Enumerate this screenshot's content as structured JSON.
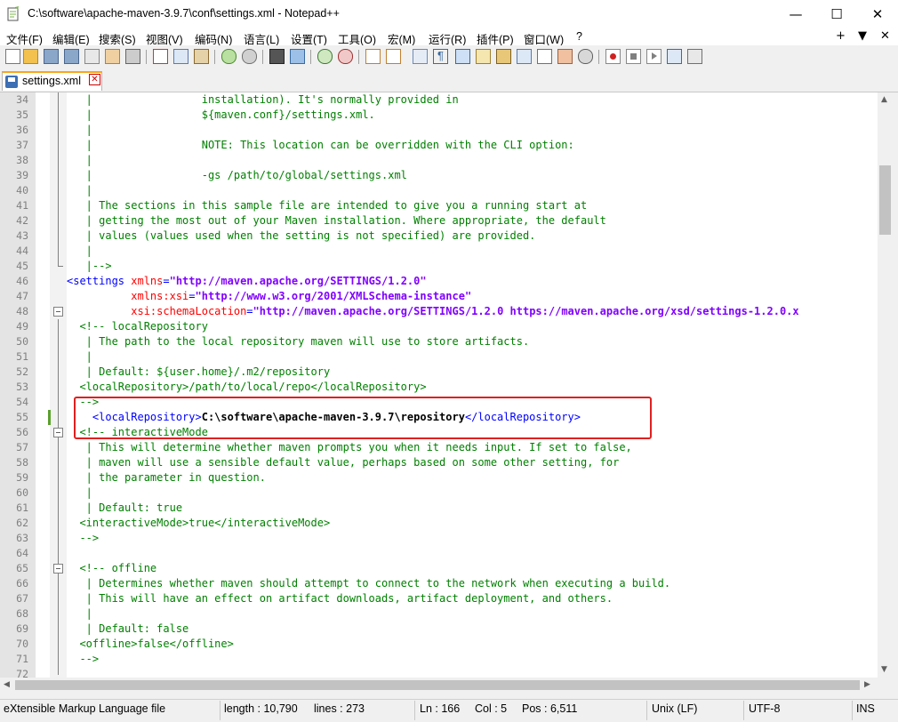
{
  "window": {
    "title": "C:\\software\\apache-maven-3.9.7\\conf\\settings.xml - Notepad++",
    "minimize": "—",
    "maximize": "☐",
    "close": "✕"
  },
  "menu": {
    "items": [
      "文件(F)",
      "编辑(E)",
      "搜索(S)",
      "视图(V)",
      "编码(N)",
      "语言(L)",
      "设置(T)",
      "工具(O)",
      "宏(M)",
      "运行(R)",
      "插件(P)",
      "窗口(W)",
      "?"
    ],
    "plus": "+",
    "dropdown": "▼",
    "close": "✕"
  },
  "toolbar": {
    "icons": [
      "new-file-icon",
      "open-file-icon",
      "save-icon",
      "save-all-icon",
      "close-icon",
      "close-all-icon",
      "print-icon",
      "cut-icon",
      "copy-icon",
      "paste-icon",
      "undo-icon",
      "redo-icon",
      "find-icon",
      "replace-icon",
      "zoom-in-icon",
      "zoom-out-icon",
      "sync-vertical-icon",
      "sync-horizontal-icon",
      "word-wrap-icon",
      "show-all-chars-icon",
      "indent-guide-icon",
      "udl-icon",
      "doc-map-icon",
      "function-list-icon",
      "folder-workspace-icon",
      "monitor-icon",
      "record-macro-icon",
      "stop-macro-icon",
      "play-macro-icon",
      "run-macro-multiple-icon",
      "save-macro-icon"
    ]
  },
  "tab": {
    "label": "settings.xml",
    "close": "✕"
  },
  "editor": {
    "lines": [
      {
        "n": "34",
        "segs": [
          {
            "t": "   |                 installation). It's normally provided in",
            "c": "c-com"
          }
        ]
      },
      {
        "n": "35",
        "segs": [
          {
            "t": "   |                 ${maven.conf}/settings.xml.",
            "c": "c-com"
          }
        ]
      },
      {
        "n": "36",
        "segs": [
          {
            "t": "   |",
            "c": "c-com"
          }
        ]
      },
      {
        "n": "37",
        "segs": [
          {
            "t": "   |                 NOTE: This location can be overridden with the CLI option:",
            "c": "c-com"
          }
        ]
      },
      {
        "n": "38",
        "segs": [
          {
            "t": "   |",
            "c": "c-com"
          }
        ]
      },
      {
        "n": "39",
        "segs": [
          {
            "t": "   |                 -gs /path/to/global/settings.xml",
            "c": "c-com"
          }
        ]
      },
      {
        "n": "40",
        "segs": [
          {
            "t": "   |",
            "c": "c-com"
          }
        ]
      },
      {
        "n": "41",
        "segs": [
          {
            "t": "   | The sections in this sample file are intended to give you a running start at",
            "c": "c-com"
          }
        ]
      },
      {
        "n": "42",
        "segs": [
          {
            "t": "   | getting the most out of your Maven installation. Where appropriate, the default",
            "c": "c-com"
          }
        ]
      },
      {
        "n": "43",
        "segs": [
          {
            "t": "   | values (values used when the setting is not specified) are provided.",
            "c": "c-com"
          }
        ]
      },
      {
        "n": "44",
        "segs": [
          {
            "t": "   |",
            "c": "c-com"
          }
        ]
      },
      {
        "n": "45",
        "segs": [
          {
            "t": "   |-->",
            "c": "c-com"
          }
        ]
      },
      {
        "n": "46",
        "segs": [
          {
            "t": "<settings ",
            "c": "c-tag"
          },
          {
            "t": "xmlns",
            "c": "c-attr"
          },
          {
            "t": "=",
            "c": "c-tag"
          },
          {
            "t": "\"http://maven.apache.org/SETTINGS/1.2.0\"",
            "c": "c-val"
          }
        ]
      },
      {
        "n": "47",
        "segs": [
          {
            "t": "          ",
            "c": "c-tag"
          },
          {
            "t": "xmlns:xsi",
            "c": "c-attr"
          },
          {
            "t": "=",
            "c": "c-tag"
          },
          {
            "t": "\"http://www.w3.org/2001/XMLSchema-instance\"",
            "c": "c-val"
          }
        ]
      },
      {
        "n": "48",
        "segs": [
          {
            "t": "          ",
            "c": "c-tag"
          },
          {
            "t": "xsi:schemaLocation",
            "c": "c-attr"
          },
          {
            "t": "=",
            "c": "c-tag"
          },
          {
            "t": "\"http://maven.apache.org/SETTINGS/1.2.0 https://maven.apache.org/xsd/settings-1.2.0.x",
            "c": "c-val"
          }
        ]
      },
      {
        "n": "49",
        "segs": [
          {
            "t": "  <!-- localRepository",
            "c": "c-com"
          }
        ]
      },
      {
        "n": "50",
        "segs": [
          {
            "t": "   | The path to the local repository maven will use to store artifacts.",
            "c": "c-com"
          }
        ]
      },
      {
        "n": "51",
        "segs": [
          {
            "t": "   |",
            "c": "c-com"
          }
        ]
      },
      {
        "n": "52",
        "segs": [
          {
            "t": "   | Default: ${user.home}/.m2/repository",
            "c": "c-com"
          }
        ]
      },
      {
        "n": "53",
        "segs": [
          {
            "t": "  <localRepository>/path/to/local/repo</localRepository>",
            "c": "c-com"
          }
        ]
      },
      {
        "n": "54",
        "segs": [
          {
            "t": "  -->",
            "c": "c-com"
          }
        ]
      },
      {
        "n": "55",
        "segs": [
          {
            "t": "    <localRepository>",
            "c": "c-tag"
          },
          {
            "t": "C:\\software\\apache-maven-3.9.7\\repository",
            "c": "c-txt"
          },
          {
            "t": "</localRepository>",
            "c": "c-tag"
          }
        ]
      },
      {
        "n": "56",
        "segs": [
          {
            "t": "  <!-- interactiveMode",
            "c": "c-com"
          }
        ]
      },
      {
        "n": "57",
        "segs": [
          {
            "t": "   | This will determine whether maven prompts you when it needs input. If set to false,",
            "c": "c-com"
          }
        ]
      },
      {
        "n": "58",
        "segs": [
          {
            "t": "   | maven will use a sensible default value, perhaps based on some other setting, for",
            "c": "c-com"
          }
        ]
      },
      {
        "n": "59",
        "segs": [
          {
            "t": "   | the parameter in question.",
            "c": "c-com"
          }
        ]
      },
      {
        "n": "60",
        "segs": [
          {
            "t": "   |",
            "c": "c-com"
          }
        ]
      },
      {
        "n": "61",
        "segs": [
          {
            "t": "   | Default: true",
            "c": "c-com"
          }
        ]
      },
      {
        "n": "62",
        "segs": [
          {
            "t": "  <interactiveMode>true</interactiveMode>",
            "c": "c-com"
          }
        ]
      },
      {
        "n": "63",
        "segs": [
          {
            "t": "  -->",
            "c": "c-com"
          }
        ]
      },
      {
        "n": "64",
        "segs": [
          {
            "t": "",
            "c": "c-com"
          }
        ]
      },
      {
        "n": "65",
        "segs": [
          {
            "t": "  <!-- offline",
            "c": "c-com"
          }
        ]
      },
      {
        "n": "66",
        "segs": [
          {
            "t": "   | Determines whether maven should attempt to connect to the network when executing a build.",
            "c": "c-com"
          }
        ]
      },
      {
        "n": "67",
        "segs": [
          {
            "t": "   | This will have an effect on artifact downloads, artifact deployment, and others.",
            "c": "c-com"
          }
        ]
      },
      {
        "n": "68",
        "segs": [
          {
            "t": "   |",
            "c": "c-com"
          }
        ]
      },
      {
        "n": "69",
        "segs": [
          {
            "t": "   | Default: false",
            "c": "c-com"
          }
        ]
      },
      {
        "n": "70",
        "segs": [
          {
            "t": "  <offline>false</offline>",
            "c": "c-com"
          }
        ]
      },
      {
        "n": "71",
        "segs": [
          {
            "t": "  -->",
            "c": "c-com"
          }
        ]
      },
      {
        "n": "72",
        "segs": [
          {
            "t": "",
            "c": "c-com"
          }
        ]
      }
    ]
  },
  "status": {
    "filetype": "eXtensible Markup Language file",
    "length": "length : 10,790",
    "lines": "lines : 273",
    "ln": "Ln : 166",
    "col": "Col : 5",
    "pos": "Pos : 6,511",
    "eol": "Unix (LF)",
    "encoding": "UTF-8",
    "mode": "INS"
  }
}
